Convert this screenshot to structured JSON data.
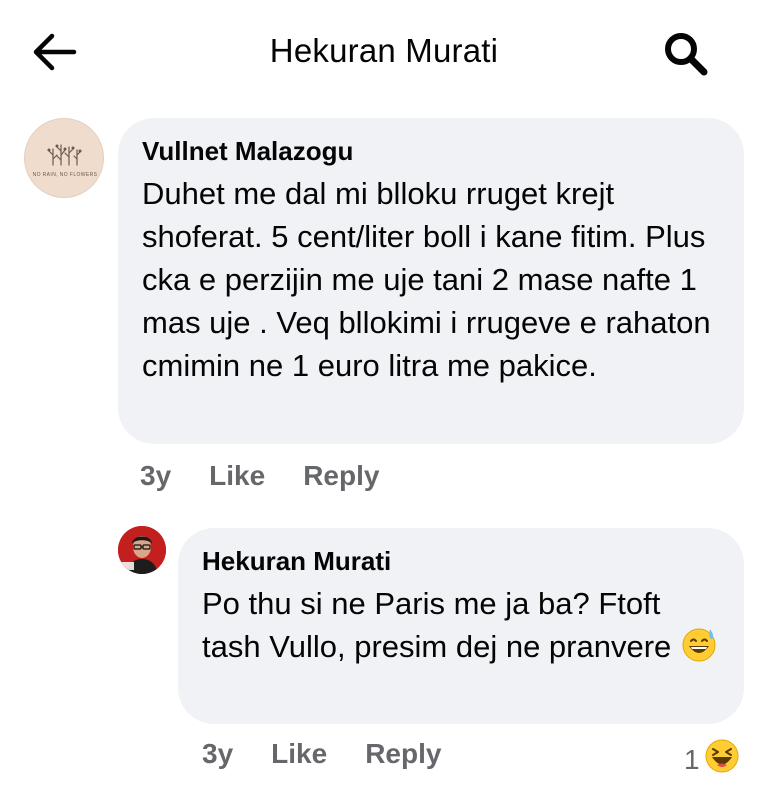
{
  "header": {
    "title": "Hekuran Murati",
    "back_icon": "arrow-left-icon",
    "search_icon": "search-icon"
  },
  "comments": [
    {
      "author": "Vullnet Malazogu",
      "avatar_text": "NO RAIN, NO FLOWERS",
      "text": "Duhet me dal mi blloku rruget krejt shoferat. 5 cent/liter boll i kane fitim. Plus cka e perzijin me uje tani 2 mase nafte 1 mas uje . Veq bllokimi i rrugeve e rahaton cmimin ne 1 euro litra me pakice.",
      "time": "3y",
      "like_label": "Like",
      "reply_label": "Reply"
    },
    {
      "author": "Hekuran Murati",
      "text": "Po thu si ne Paris me ja ba? Ftoft tash Vullo, presim dej ne pranvere",
      "emoji_icon": "grinning-sweat-emoji-icon",
      "time": "3y",
      "like_label": "Like",
      "reply_label": "Reply",
      "reaction_count": "1",
      "reaction_icon": "haha-reaction-icon"
    }
  ],
  "colors": {
    "bubble": "#f0f2f5",
    "meta_text": "#65676b",
    "avatar2_bg": "#c41f1f"
  }
}
